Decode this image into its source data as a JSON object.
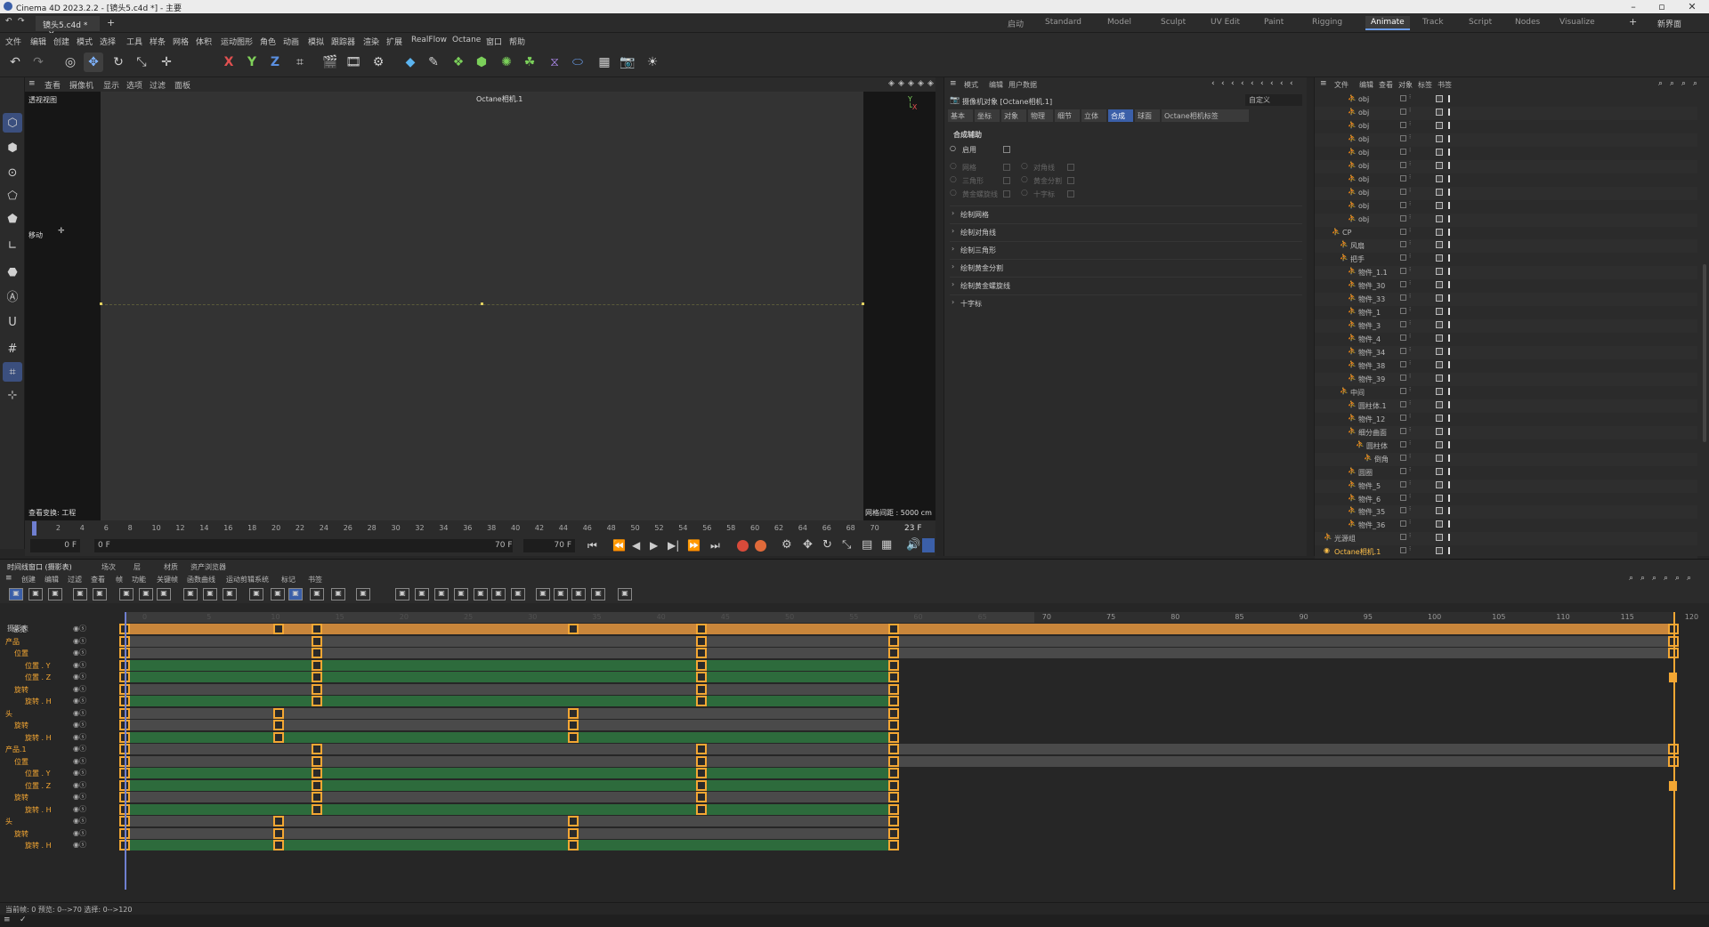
{
  "window": {
    "title": "Cinema 4D 2023.2.2 - [镜头5.c4d *] - 主要"
  },
  "doc_tab": {
    "label": "镜头5.c4d *"
  },
  "layouts": [
    "启动",
    "Standard",
    "Model",
    "Sculpt",
    "UV Edit",
    "Paint",
    "Rigging",
    "Animate",
    "Track",
    "Script",
    "Nodes",
    "Visualize"
  ],
  "active_layout": "Animate",
  "new_layout": "新界面",
  "menus": [
    "文件",
    "编辑",
    "创建",
    "模式",
    "选择",
    "工具",
    "样条",
    "网格",
    "体积",
    "运动图形",
    "角色",
    "动画",
    "模拟",
    "跟踪器",
    "渲染",
    "扩展",
    "RealFlow",
    "Octane",
    "窗口",
    "帮助"
  ],
  "axis_labels": {
    "x": "X",
    "y": "Y",
    "z": "Z"
  },
  "viewport": {
    "menu": [
      "查看",
      "摄像机",
      "显示",
      "选项",
      "过滤",
      "面板"
    ],
    "name": "透视视图",
    "camera": "Octane相机.1",
    "move_label": "移动",
    "view_transform": "查看变换: 工程",
    "grid_spacing": "网格间距 : 5000 cm"
  },
  "ruler": {
    "ticks": [
      "0",
      "2",
      "4",
      "6",
      "8",
      "10",
      "12",
      "14",
      "16",
      "18",
      "20",
      "22",
      "24",
      "26",
      "28",
      "30",
      "32",
      "34",
      "36",
      "38",
      "40",
      "42",
      "44",
      "46",
      "48",
      "50",
      "52",
      "54",
      "56",
      "58",
      "60",
      "62",
      "64",
      "66",
      "68",
      "70"
    ],
    "current": "23 F"
  },
  "transport": {
    "start": "0 F",
    "min": "0 F",
    "max": "70 F",
    "end": "70 F"
  },
  "attributes": {
    "menu": [
      "模式",
      "编辑",
      "用户数据"
    ],
    "object": "摄像机对象 [Octane相机.1]",
    "preset": "自定义",
    "tabs": [
      "基本",
      "坐标",
      "对象",
      "物理",
      "细节",
      "立体",
      "合成",
      "球面",
      "Octane相机标签"
    ],
    "active_tab": "合成",
    "section": "合成辅助",
    "enable": "启用",
    "opts_left": [
      "网格",
      "三角形",
      "黄金螺旋线"
    ],
    "opts_right": [
      "对角线",
      "黄金分割",
      "十字标"
    ],
    "groups": [
      "绘制网格",
      "绘制对角线",
      "绘制三角形",
      "绘制黄金分割",
      "绘制黄金螺旋线",
      "十字标"
    ]
  },
  "objmgr": {
    "menu": [
      "文件",
      "编辑",
      "查看",
      "对象",
      "标签",
      "书签"
    ],
    "rows": [
      {
        "name": "obj",
        "indent": 3
      },
      {
        "name": "obj",
        "indent": 3
      },
      {
        "name": "obj",
        "indent": 3
      },
      {
        "name": "obj",
        "indent": 3
      },
      {
        "name": "obj",
        "indent": 3
      },
      {
        "name": "obj",
        "indent": 3
      },
      {
        "name": "obj",
        "indent": 3
      },
      {
        "name": "obj",
        "indent": 3
      },
      {
        "name": "obj",
        "indent": 3
      },
      {
        "name": "obj",
        "indent": 3
      },
      {
        "name": "CP",
        "indent": 1
      },
      {
        "name": "风扇",
        "indent": 2
      },
      {
        "name": "把手",
        "indent": 2
      },
      {
        "name": "物件_1.1",
        "indent": 3
      },
      {
        "name": "物件_30",
        "indent": 3
      },
      {
        "name": "物件_33",
        "indent": 3
      },
      {
        "name": "物件_1",
        "indent": 3
      },
      {
        "name": "物件_3",
        "indent": 3
      },
      {
        "name": "物件_4",
        "indent": 3
      },
      {
        "name": "物件_34",
        "indent": 3
      },
      {
        "name": "物件_38",
        "indent": 3
      },
      {
        "name": "物件_39",
        "indent": 3
      },
      {
        "name": "中间",
        "indent": 2
      },
      {
        "name": "圆柱体.1",
        "indent": 3
      },
      {
        "name": "物件_12",
        "indent": 3
      },
      {
        "name": "细分曲面",
        "indent": 3
      },
      {
        "name": "圆柱体",
        "indent": 4
      },
      {
        "name": "倒角",
        "indent": 5
      },
      {
        "name": "圆圈",
        "indent": 3
      },
      {
        "name": "物件_5",
        "indent": 3
      },
      {
        "name": "物件_6",
        "indent": 3
      },
      {
        "name": "物件_35",
        "indent": 3
      },
      {
        "name": "物件_36",
        "indent": 3
      },
      {
        "name": "光源组",
        "indent": 0
      },
      {
        "name": "Octane相机.1",
        "indent": 0
      }
    ]
  },
  "dopesheet": {
    "title": "时间线窗口 (摄影表)",
    "tabs": [
      "场次",
      "层",
      "材质",
      "资产浏览器"
    ],
    "menu": [
      "创建",
      "编辑",
      "过滤",
      "查看",
      "帧",
      "功能",
      "关键帧",
      "函数曲线",
      "运动剪辑系统",
      "标记",
      "书签"
    ],
    "mode": "摄影表",
    "ruler": [
      "0",
      "5",
      "10",
      "15",
      "20",
      "25",
      "30",
      "35",
      "40",
      "45",
      "50",
      "55",
      "60",
      "65",
      "70",
      "75",
      "80",
      "85",
      "90",
      "95",
      "100",
      "105",
      "110",
      "115",
      "120"
    ],
    "tracks": [
      {
        "label": "总览",
        "type": "summary"
      },
      {
        "label": "产品",
        "type": "obj"
      },
      {
        "label": "位置",
        "type": "grp"
      },
      {
        "label": "位置 . Y",
        "type": "trk"
      },
      {
        "label": "位置 . Z",
        "type": "trk"
      },
      {
        "label": "旋转",
        "type": "grp"
      },
      {
        "label": "旋转 . H",
        "type": "trk"
      },
      {
        "label": "头",
        "type": "obj"
      },
      {
        "label": "旋转",
        "type": "grp"
      },
      {
        "label": "旋转 . H",
        "type": "trk"
      },
      {
        "label": "产品.1",
        "type": "obj"
      },
      {
        "label": "位置",
        "type": "grp"
      },
      {
        "label": "位置 . Y",
        "type": "trk"
      },
      {
        "label": "位置 . Z",
        "type": "trk"
      },
      {
        "label": "旋转",
        "type": "grp"
      },
      {
        "label": "旋转 . H",
        "type": "trk"
      },
      {
        "label": "头",
        "type": "obj"
      },
      {
        "label": "旋转",
        "type": "grp"
      },
      {
        "label": "旋转 . H",
        "type": "trk"
      }
    ]
  },
  "status": "当前帧: 0  预览: 0-->70  选择: 0-->120"
}
